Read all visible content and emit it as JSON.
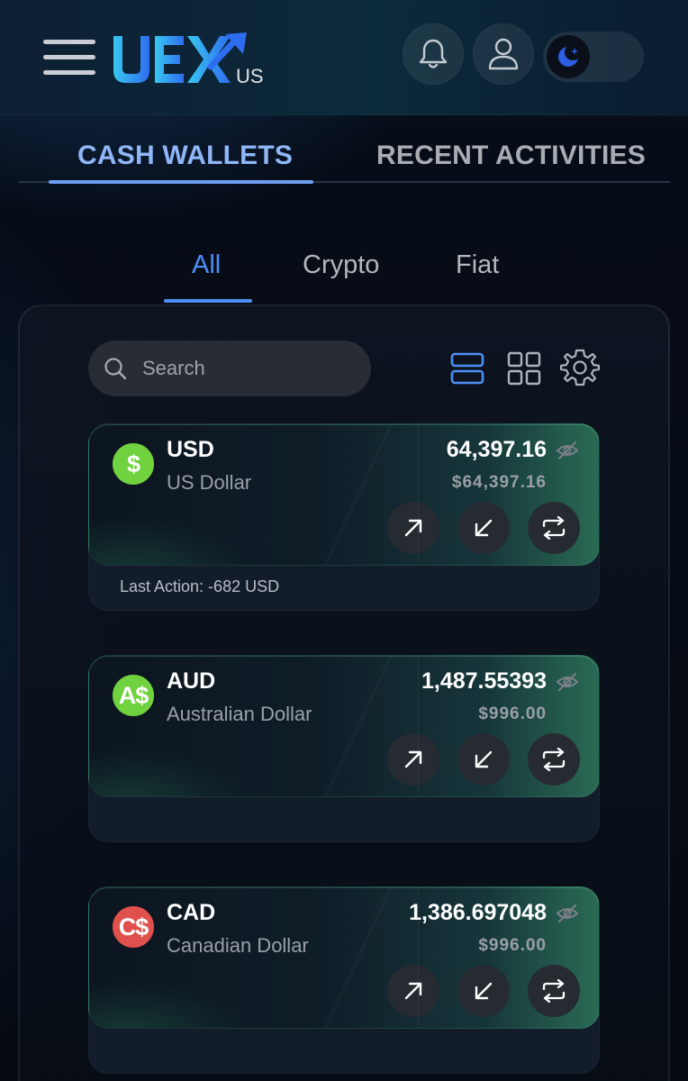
{
  "header": {
    "logo_text": "UEX",
    "logo_sub": "US",
    "accent": "#4d8ef5"
  },
  "main_tabs": [
    {
      "label": "CASH WALLETS",
      "active": true
    },
    {
      "label": "RECENT ACTIVITIES",
      "active": false
    }
  ],
  "sub_tabs": [
    {
      "label": "All",
      "active": true
    },
    {
      "label": "Crypto",
      "active": false
    },
    {
      "label": "Fiat",
      "active": false
    }
  ],
  "search": {
    "placeholder": "Search"
  },
  "toolbar_icons": [
    "list-view-icon",
    "grid-view-icon",
    "settings-icon"
  ],
  "wallets": [
    {
      "symbol": "$",
      "code": "USD",
      "name": "US Dollar",
      "amount": "64,397.16",
      "usd_value": "$64,397.16",
      "last_action": "Last Action: -682 USD",
      "coin_color": "#6fd23e"
    },
    {
      "symbol": "A$",
      "code": "AUD",
      "name": "Australian Dollar",
      "amount": "1,487.55393",
      "usd_value": "$996.00",
      "last_action": "",
      "coin_color": "#6fd23e"
    },
    {
      "symbol": "C$",
      "code": "CAD",
      "name": "Canadian Dollar",
      "amount": "1,386.697048",
      "usd_value": "$996.00",
      "last_action": "",
      "coin_color": "#e0514d"
    }
  ]
}
